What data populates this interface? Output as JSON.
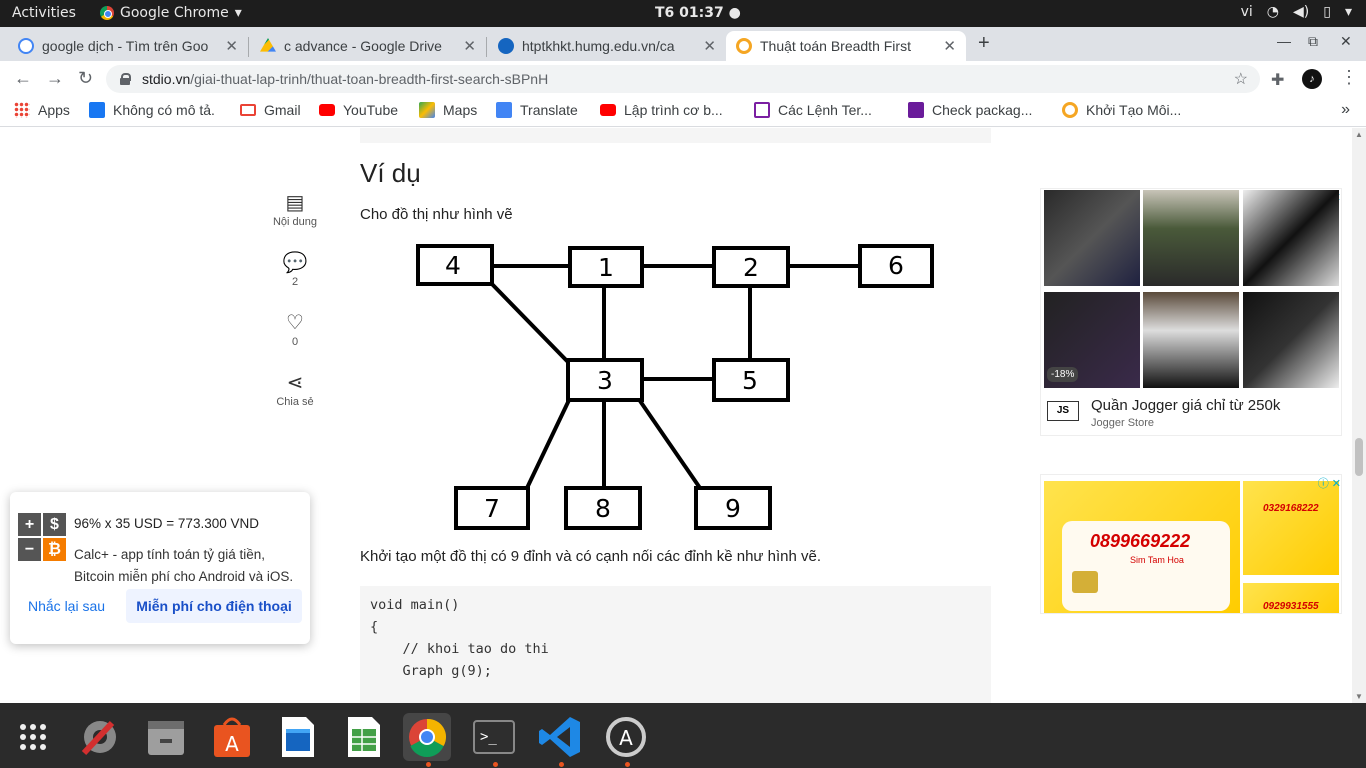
{
  "system_bar": {
    "activities": "Activities",
    "app_name": "Google Chrome",
    "clock": "T6 01:37",
    "language": "vi"
  },
  "tabs": [
    {
      "label": "google dịch - Tìm trên Goo",
      "favicon_color": "#4285f4"
    },
    {
      "label": "c advance - Google Drive",
      "favicon_color": "#fbbc04"
    },
    {
      "label": "htptkhkt.humg.edu.vn/ca",
      "favicon_color": "#1565c0"
    },
    {
      "label": "Thuật toán Breadth First",
      "favicon_color": "#f5a623"
    }
  ],
  "address": {
    "host": "stdio.vn",
    "path": "/giai-thuat-lap-trinh/thuat-toan-breadth-first-search-sBPnH"
  },
  "bookmarks": [
    {
      "label": "Apps",
      "color": "#ea4335"
    },
    {
      "label": "Không có mô tả.",
      "color": "#1877f2"
    },
    {
      "label": "Gmail",
      "color": "#ea4335"
    },
    {
      "label": "YouTube",
      "color": "#ff0000"
    },
    {
      "label": "Maps",
      "color": "#34a853"
    },
    {
      "label": "Translate",
      "color": "#4285f4"
    },
    {
      "label": "Lập trình cơ b...",
      "color": "#ff0000"
    },
    {
      "label": "Các Lệnh Ter...",
      "color": "#7b1fa2"
    },
    {
      "label": "Check packag...",
      "color": "#6a1b9a"
    },
    {
      "label": "Khởi Tạo Môi...",
      "color": "#f5a623"
    }
  ],
  "side_actions": [
    {
      "name": "toc",
      "label": "Nội dung"
    },
    {
      "name": "comments",
      "label": "2"
    },
    {
      "name": "likes",
      "label": "0"
    },
    {
      "name": "share",
      "label": "Chia sẻ"
    }
  ],
  "article": {
    "heading": "Ví dụ",
    "intro": "Cho đồ thị như hình vẽ",
    "after": "Khởi tạo một đồ thị có 9 đỉnh và có cạnh nối các đỉnh kề như hình vẽ.",
    "code_lines": [
      "void main()",
      "{",
      "    // khoi tao do thi",
      "    Graph g(9);"
    ]
  },
  "graph": {
    "nodes": [
      "1",
      "2",
      "3",
      "4",
      "5",
      "6",
      "7",
      "8",
      "9"
    ],
    "edges": [
      [
        "4",
        "1"
      ],
      [
        "1",
        "2"
      ],
      [
        "2",
        "6"
      ],
      [
        "4",
        "3"
      ],
      [
        "1",
        "3"
      ],
      [
        "2",
        "5"
      ],
      [
        "3",
        "5"
      ],
      [
        "3",
        "7"
      ],
      [
        "3",
        "8"
      ],
      [
        "3",
        "9"
      ]
    ]
  },
  "ads": {
    "jogger_title": "Quần Jogger giá chỉ từ 250k",
    "jogger_brand": "Jogger Store",
    "jogger_logo": "JS",
    "jogger_discount": "-18%",
    "sim_number": "0899669222",
    "sim_label": "Sim Tam Hoa",
    "sim_side_1": "0329168222",
    "sim_side_2": "0929931555"
  },
  "popup": {
    "line1": "96% x 35 USD = 773.300 VND",
    "line2": "Calc+ - app tính toán tỷ giá tiền, Bitcoin miễn phí cho Android và iOS.",
    "later": "Nhắc lại sau",
    "free": "Miễn phí cho điện thoại",
    "icon_symbols": [
      "+",
      "$",
      "−",
      "₿"
    ]
  }
}
